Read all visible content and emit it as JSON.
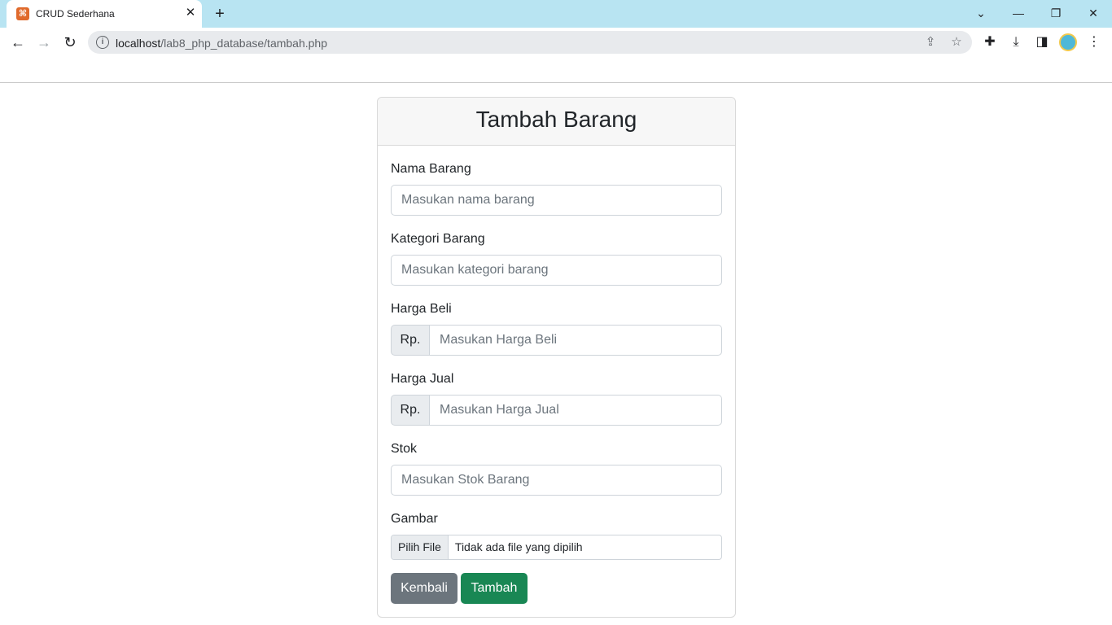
{
  "browser": {
    "tab_title": "CRUD Sederhana",
    "tab_close": "✕",
    "new_tab": "+",
    "url_host": "localhost",
    "url_path": "/lab8_php_database/tambah.php",
    "window_controls": {
      "chevron": "⌄",
      "minimize": "—",
      "restore": "❐",
      "close": "✕"
    }
  },
  "form": {
    "title": "Tambah Barang",
    "fields": {
      "nama": {
        "label": "Nama Barang",
        "placeholder": "Masukan nama barang"
      },
      "kategori": {
        "label": "Kategori Barang",
        "placeholder": "Masukan kategori barang"
      },
      "harga_beli": {
        "label": "Harga Beli",
        "prefix": "Rp.",
        "placeholder": "Masukan Harga Beli"
      },
      "harga_jual": {
        "label": "Harga Jual",
        "prefix": "Rp.",
        "placeholder": "Masukan Harga Jual"
      },
      "stok": {
        "label": "Stok",
        "placeholder": "Masukan Stok Barang"
      },
      "gambar": {
        "label": "Gambar",
        "button": "Pilih File",
        "status": "Tidak ada file yang dipilih"
      }
    },
    "buttons": {
      "back": "Kembali",
      "submit": "Tambah"
    }
  },
  "colors": {
    "tabstrip": "#b8e4f2",
    "secondary": "#6c757d",
    "success": "#198754"
  }
}
